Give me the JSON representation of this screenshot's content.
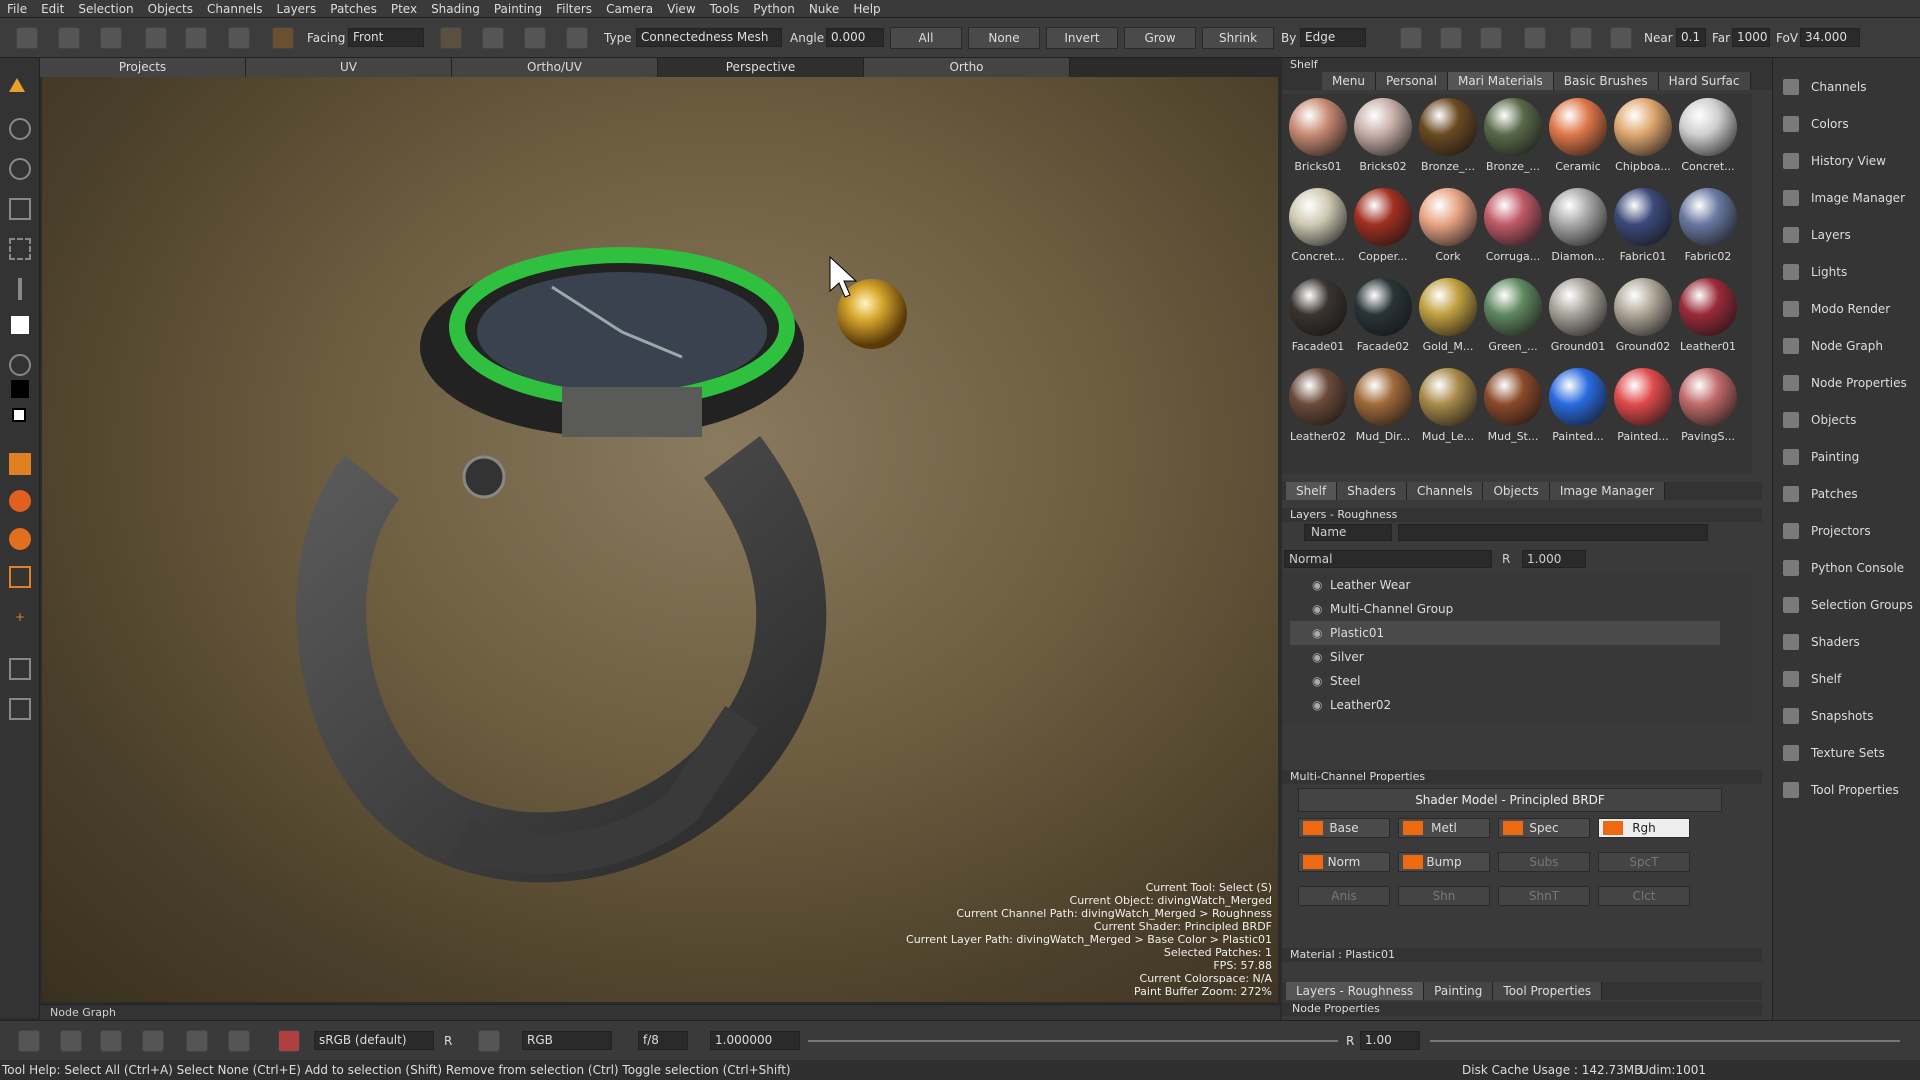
{
  "menu": [
    "File",
    "Edit",
    "Selection",
    "Objects",
    "Channels",
    "Layers",
    "Patches",
    "Ptex",
    "Shading",
    "Painting",
    "Filters",
    "Camera",
    "View",
    "Tools",
    "Python",
    "Nuke",
    "Help"
  ],
  "toolbar": {
    "facing_label": "Facing",
    "facing_value": "Front",
    "type_label": "Type",
    "type_value": "Connectedness Mesh",
    "angle_label": "Angle",
    "angle_value": "0.000",
    "all": "All",
    "none": "None",
    "invert": "Invert",
    "grow": "Grow",
    "shrink": "Shrink",
    "by_label": "By",
    "by_value": "Edge",
    "near_label": "Near",
    "near_value": "0.1",
    "far_label": "Far",
    "far_value": "1000",
    "fov_label": "FoV",
    "fov_value": "34.000"
  },
  "view_tabs": [
    "Projects",
    "UV",
    "Ortho/UV",
    "Perspective",
    "Ortho"
  ],
  "viewport_info": [
    "Current Tool: Select (S)",
    "Current Object: divingWatch_Merged",
    "Current Channel Path: divingWatch_Merged > Roughness",
    "Current Shader: Principled BRDF",
    "Current Layer Path: divingWatch_Merged > Base Color > Plastic01",
    "Selected Patches: 1",
    "FPS: 57.88",
    "Current Colorspace: N/A",
    "Paint Buffer Zoom: 272%"
  ],
  "node_graph_label": "Node Graph",
  "shelf": {
    "title": "Shelf",
    "tabs": [
      "Menu",
      "Personal",
      "Mari Materials",
      "Basic Brushes",
      "Hard Surfac"
    ],
    "materials": [
      {
        "n": "Bricks01",
        "c": "#c98b74"
      },
      {
        "n": "Bricks02",
        "c": "#c9b0a8"
      },
      {
        "n": "Bronze_...",
        "c": "#6b4a22"
      },
      {
        "n": "Bronze_...",
        "c": "#5b6a4a"
      },
      {
        "n": "Ceramic",
        "c": "#e0784a"
      },
      {
        "n": "Chipboa...",
        "c": "#e0a870"
      },
      {
        "n": "Concret...",
        "c": "#cfcfcf"
      },
      {
        "n": "Concret...",
        "c": "#d0cab4"
      },
      {
        "n": "Copper...",
        "c": "#a03020"
      },
      {
        "n": "Cork",
        "c": "#e8a484"
      },
      {
        "n": "Corruga...",
        "c": "#c05a68"
      },
      {
        "n": "Diamon...",
        "c": "#a8a8a8"
      },
      {
        "n": "Fabric01",
        "c": "#3c4a7a"
      },
      {
        "n": "Fabric02",
        "c": "#6878a0"
      },
      {
        "n": "Facade01",
        "c": "#3a3430"
      },
      {
        "n": "Facade02",
        "c": "#2a3438"
      },
      {
        "n": "Gold_M...",
        "c": "#c0a040"
      },
      {
        "n": "Green_...",
        "c": "#608860"
      },
      {
        "n": "Ground01",
        "c": "#a8a49c"
      },
      {
        "n": "Ground02",
        "c": "#b0a898"
      },
      {
        "n": "Leather01",
        "c": "#9a2a3a"
      },
      {
        "n": "Leather02",
        "c": "#6a4a3a"
      },
      {
        "n": "Mud_Dir...",
        "c": "#a06a3a"
      },
      {
        "n": "Mud_Le...",
        "c": "#a88a4a"
      },
      {
        "n": "Mud_St...",
        "c": "#8a4a2a"
      },
      {
        "n": "Painted...",
        "c": "#2a6ae0"
      },
      {
        "n": "Painted...",
        "c": "#e04a4a"
      },
      {
        "n": "PavingS...",
        "c": "#c06a6a"
      }
    ],
    "bottom_tabs": [
      "Shelf",
      "Shaders",
      "Channels",
      "Objects",
      "Image Manager"
    ]
  },
  "layers": {
    "title": "Layers - Roughness",
    "filter_label": "Name",
    "blend": "Normal",
    "opacity": "1.000",
    "r": "R",
    "items": [
      "Leather Wear",
      "Multi-Channel Group",
      "Plastic01",
      "Silver",
      "Steel",
      "Leather02"
    ]
  },
  "mcp": {
    "title": "Multi-Channel Properties",
    "shader_model": "Shader Model - Principled BRDF",
    "channels": [
      {
        "l": "Base",
        "on": true
      },
      {
        "l": "Metl",
        "on": true
      },
      {
        "l": "Spec",
        "on": true
      },
      {
        "l": "Rgh",
        "on": true
      },
      {
        "l": "Norm",
        "on": true
      },
      {
        "l": "Bump",
        "on": true
      },
      {
        "l": "Subs",
        "on": false
      },
      {
        "l": "SpcT",
        "on": false
      },
      {
        "l": "Anis",
        "on": false
      },
      {
        "l": "Shn",
        "on": false
      },
      {
        "l": "ShnT",
        "on": false
      },
      {
        "l": "Clct",
        "on": false
      }
    ],
    "material": "Material : Plastic01",
    "bottom_tabs": [
      "Layers - Roughness",
      "Painting",
      "Tool Properties"
    ],
    "node_props": "Node Properties"
  },
  "dock": [
    "Channels",
    "Colors",
    "History View",
    "Image Manager",
    "Layers",
    "Lights",
    "Modo Render",
    "Node Graph",
    "Node Properties",
    "Objects",
    "Painting",
    "Patches",
    "Projectors",
    "Python Console",
    "Selection Groups",
    "Shaders",
    "Shelf",
    "Snapshots",
    "Texture Sets",
    "Tool Properties"
  ],
  "bottom": {
    "colorspace": "sRGB (default)",
    "r": "R",
    "channel": "RGB",
    "fstop": "f/8",
    "exposure": "1.000000",
    "gain_r": "R",
    "gain": "1.00"
  },
  "status": {
    "help": "Tool Help: Select All (Ctrl+A)   Select None (Ctrl+E)   Add to selection (Shift)   Remove from selection (Ctrl)   Toggle selection (Ctrl+Shift)",
    "disk": "Disk Cache Usage : 142.73MB",
    "udim": "Udim:1001"
  }
}
